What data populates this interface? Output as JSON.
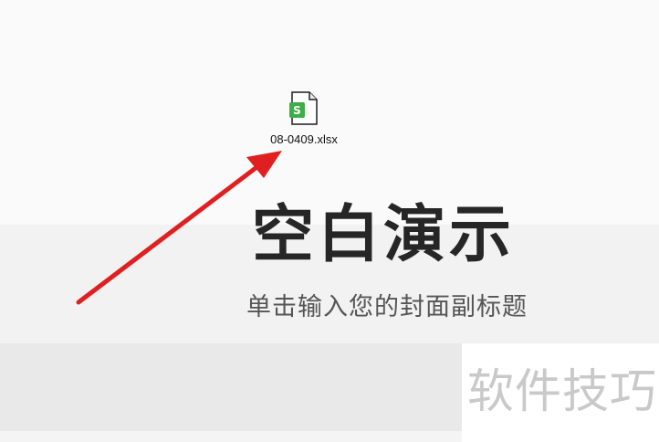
{
  "desktop": {
    "file": {
      "name": "08-0409.xlsx",
      "icon": "spreadsheet-file-icon",
      "icon_letter": "S",
      "icon_color": "#3fae49"
    }
  },
  "slide": {
    "title": "空白演示",
    "subtitle": "单击输入您的封面副标题"
  },
  "watermark": {
    "text": "软件技巧"
  },
  "annotation": {
    "arrow_color": "#e02020"
  }
}
